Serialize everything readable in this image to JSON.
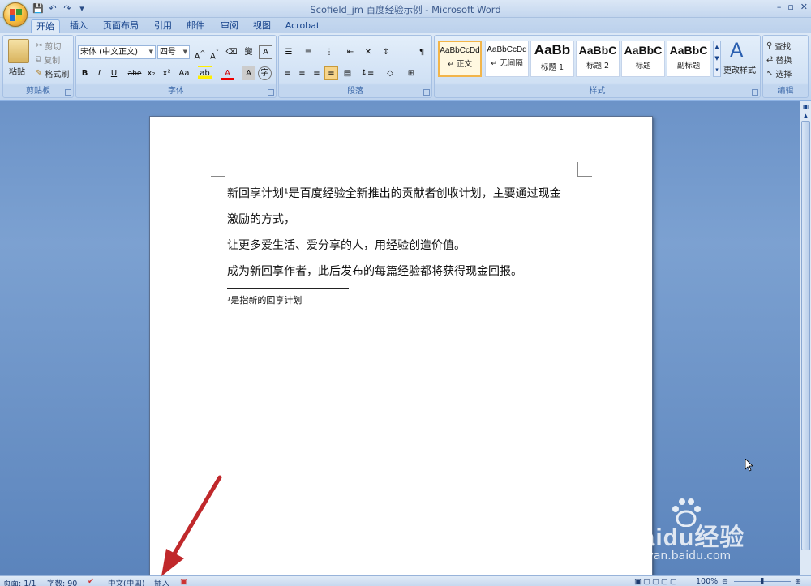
{
  "window": {
    "title": "Scofield_jm 百度经验示例 - Microsoft Word",
    "controls": [
      "–",
      "▫",
      "✕"
    ]
  },
  "quick_access": {
    "icons": [
      "save-icon",
      "undo-icon",
      "redo-icon",
      "customize-icon"
    ]
  },
  "tabs": [
    "开始",
    "插入",
    "页面布局",
    "引用",
    "邮件",
    "审阅",
    "视图",
    "Acrobat"
  ],
  "active_tab": "开始",
  "ribbon": {
    "clipboard": {
      "label": "剪贴板",
      "paste": "粘贴",
      "cut": "剪切",
      "copy": "复制",
      "format_painter": "格式刷"
    },
    "font": {
      "label": "字体",
      "font_name": "宋体 (中文正文)",
      "font_size": "四号",
      "buttons": [
        "B",
        "I",
        "U",
        "abe",
        "x₂",
        "x²",
        "Aa",
        "A",
        "A"
      ]
    },
    "paragraph": {
      "label": "段落"
    },
    "styles": {
      "label": "样式",
      "items": [
        {
          "sample": "AaBbCcDd",
          "name": "↵ 正文",
          "selected": true
        },
        {
          "sample": "AaBbCcDd",
          "name": "↵ 无间隔"
        },
        {
          "sample": "AaBb",
          "name": "标题 1"
        },
        {
          "sample": "AaBbC",
          "name": "标题 2"
        },
        {
          "sample": "AaBbC",
          "name": "标题"
        },
        {
          "sample": "AaBbC",
          "name": "副标题"
        }
      ],
      "change_styles": "更改样式"
    },
    "editing": {
      "label": "编辑",
      "find": "查找",
      "replace": "替换",
      "select": "选择"
    }
  },
  "document": {
    "lines": [
      "新回享计划¹是百度经验全新推出的贡献者创收计划，主要通过现金",
      "激励的方式，",
      "让更多爱生活、爱分享的人，用经验创造价值。",
      "成为新回享作者，此后发布的每篇经验都将获得现金回报。"
    ],
    "footnote": "¹是指新的回享计划"
  },
  "status": {
    "page": "页面: 1/1",
    "words": "字数: 90",
    "language": "中文(中国)",
    "mode": "插入",
    "zoom": "100%"
  },
  "watermark": {
    "brand": "Baidu经验",
    "url": "jingyan.baidu.com"
  },
  "colors": {
    "accent": "#f2b54a",
    "arrow": "#c0282b",
    "ribbon": "#c8daf1"
  }
}
